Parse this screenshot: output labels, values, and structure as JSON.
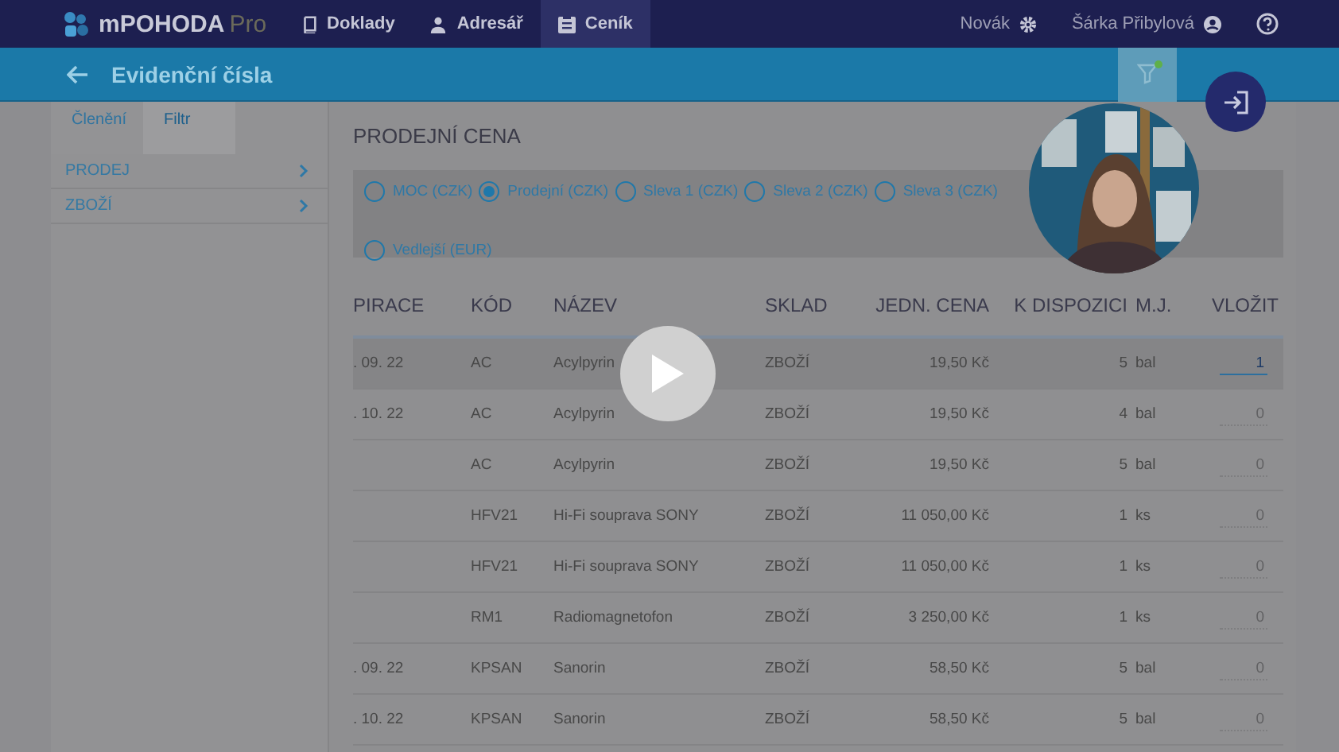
{
  "nav": {
    "brand": "mPOHODA",
    "brand_suffix": "Pro",
    "tabs": [
      {
        "label": "Doklady",
        "selected": false
      },
      {
        "label": "Adresář",
        "selected": false
      },
      {
        "label": "Ceník",
        "selected": true
      }
    ],
    "company": "Novák",
    "user": "Šárka Přibylová"
  },
  "header": {
    "title": "Evidenční čísla",
    "filter_active": true
  },
  "sidebar": {
    "tabs": [
      {
        "label": "Členění",
        "selected": true
      },
      {
        "label": "Filtr",
        "selected": false
      }
    ],
    "items": [
      {
        "label": "PRODEJ"
      },
      {
        "label": "ZBOŽÍ"
      }
    ]
  },
  "price": {
    "title": "PRODEJNÍ CENA",
    "options": [
      {
        "label": "MOC (CZK)",
        "selected": false
      },
      {
        "label": "Prodejní (CZK)",
        "selected": true
      },
      {
        "label": "Sleva 1 (CZK)",
        "selected": false
      },
      {
        "label": "Sleva 2 (CZK)",
        "selected": false
      },
      {
        "label": "Sleva 3 (CZK)",
        "selected": false
      },
      {
        "label": "Vedlejší (EUR)",
        "selected": false
      }
    ]
  },
  "table": {
    "columns": [
      "PIRACE",
      "KÓD",
      "NÁZEV",
      "SKLAD",
      "JEDN. CENA",
      "K DISPOZICI",
      "M.J.",
      "VLOŽIT"
    ],
    "rows": [
      {
        "cells": [
          ". 09. 22",
          "AC",
          "Acylpyrin",
          "ZBOŽÍ",
          "19,50 Kč",
          "5",
          "bal"
        ],
        "insert": "1",
        "selected": true
      },
      {
        "cells": [
          ". 10. 22",
          "AC",
          "Acylpyrin",
          "ZBOŽÍ",
          "19,50 Kč",
          "4",
          "bal"
        ],
        "insert": "0",
        "selected": false
      },
      {
        "cells": [
          "",
          "AC",
          "Acylpyrin",
          "ZBOŽÍ",
          "19,50 Kč",
          "5",
          "bal"
        ],
        "insert": "0",
        "selected": false
      },
      {
        "cells": [
          "",
          "HFV21",
          "Hi-Fi souprava SONY",
          "ZBOŽÍ",
          "11 050,00 Kč",
          "1",
          "ks"
        ],
        "insert": "0",
        "selected": false
      },
      {
        "cells": [
          "",
          "HFV21",
          "Hi-Fi souprava SONY",
          "ZBOŽÍ",
          "11 050,00 Kč",
          "1",
          "ks"
        ],
        "insert": "0",
        "selected": false
      },
      {
        "cells": [
          "",
          "RM1",
          "Radiomagnetofon",
          "ZBOŽÍ",
          "3 250,00 Kč",
          "1",
          "ks"
        ],
        "insert": "0",
        "selected": false
      },
      {
        "cells": [
          ". 09. 22",
          "KPSAN",
          "Sanorin",
          "ZBOŽÍ",
          "58,50 Kč",
          "5",
          "bal"
        ],
        "insert": "0",
        "selected": false
      },
      {
        "cells": [
          ". 10. 22",
          "KPSAN",
          "Sanorin",
          "ZBOŽÍ",
          "58,50 Kč",
          "5",
          "bal"
        ],
        "insert": "0",
        "selected": false
      }
    ]
  }
}
